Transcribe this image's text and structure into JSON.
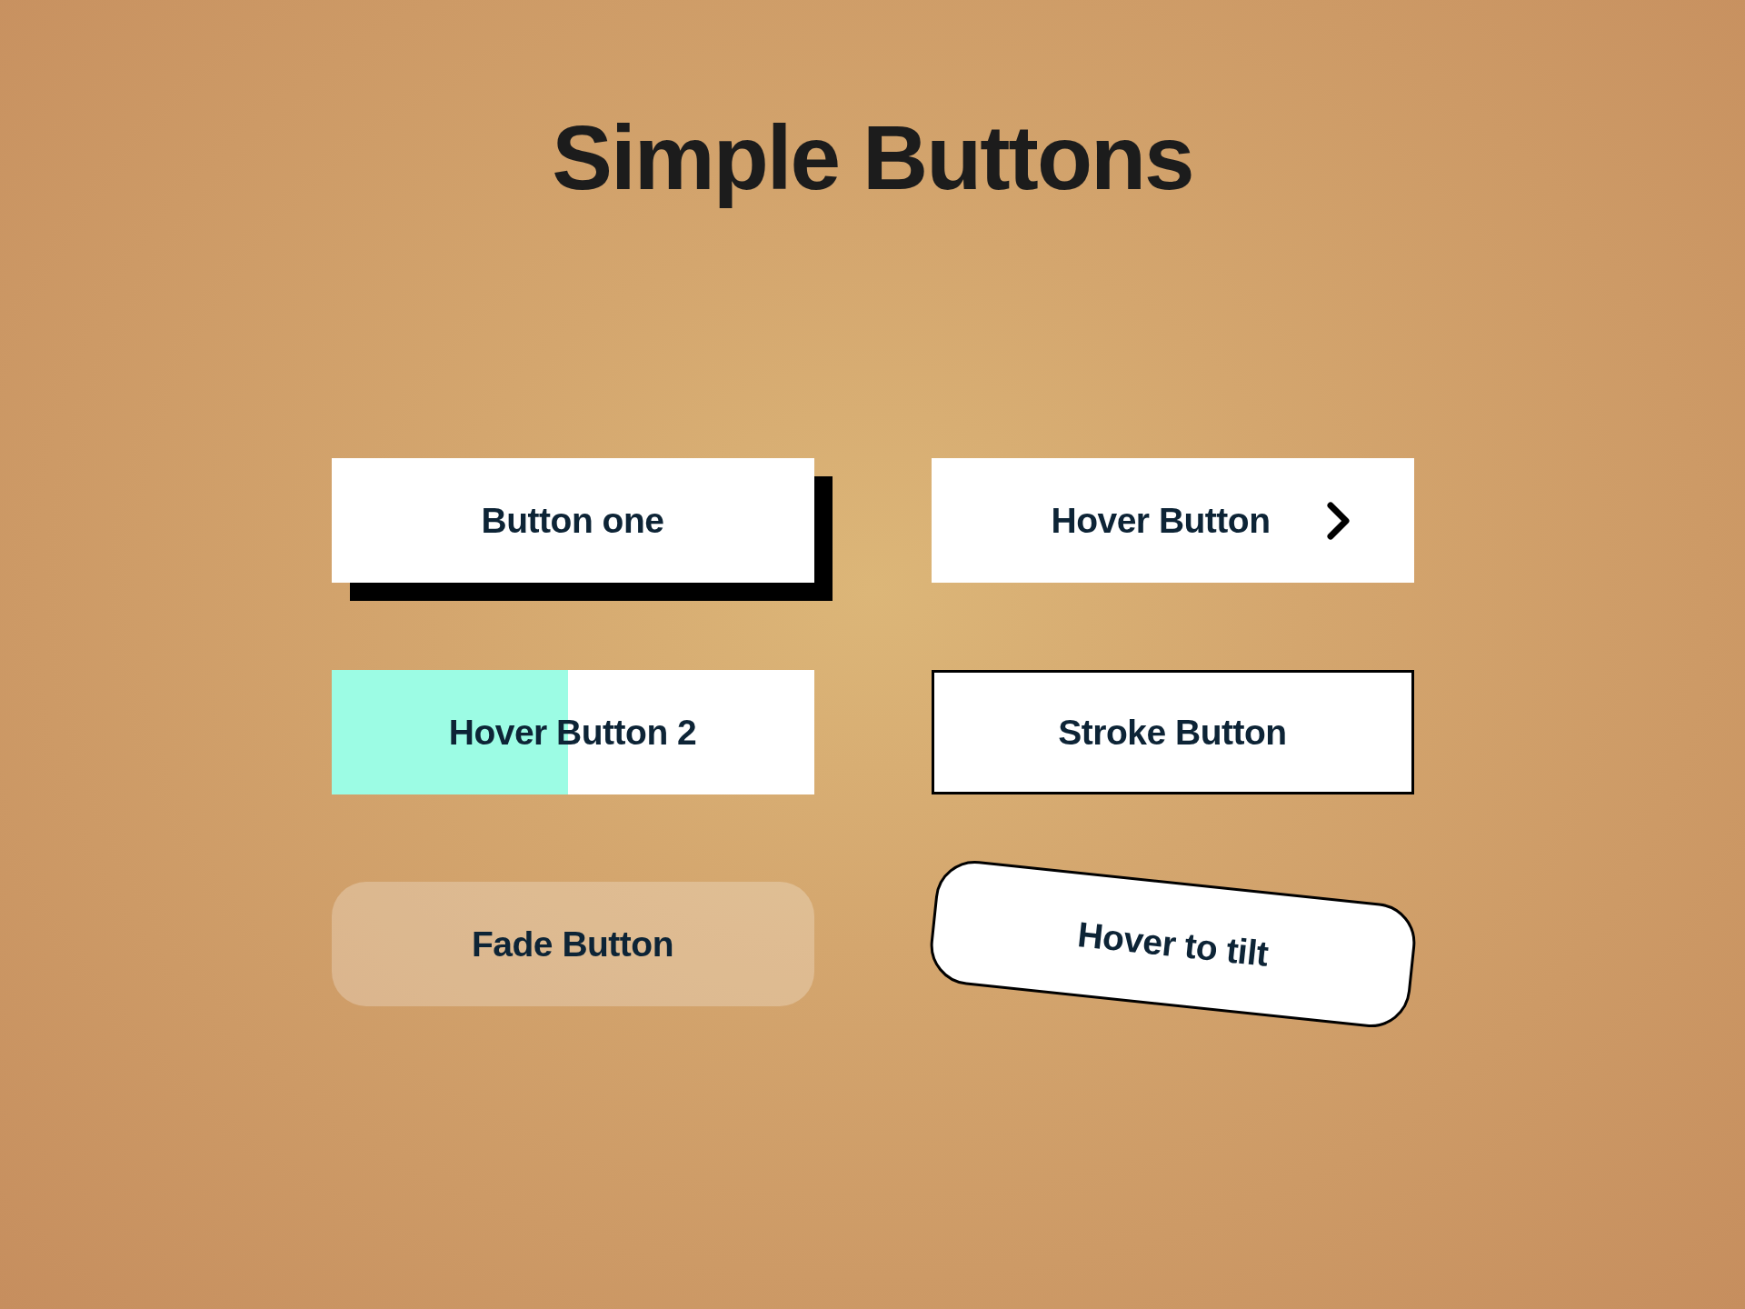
{
  "title": "Simple Buttons",
  "buttons": [
    {
      "kind": "shadow",
      "label": "Button one"
    },
    {
      "kind": "arrow",
      "label": "Hover Button"
    },
    {
      "kind": "fill",
      "label": "Hover Button 2",
      "level": 0.49
    },
    {
      "kind": "stroke",
      "label": "Stroke Button"
    },
    {
      "kind": "fade",
      "label": "Fade Button"
    },
    {
      "kind": "tilt",
      "label": "Hover to tilt"
    }
  ]
}
